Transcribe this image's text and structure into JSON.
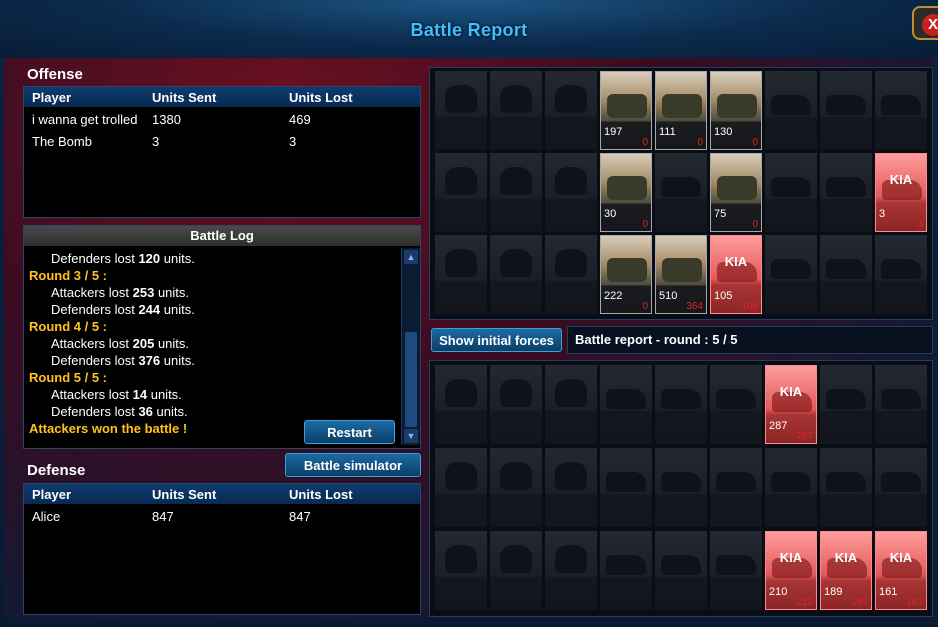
{
  "window": {
    "title": "Battle Report",
    "close_glyph": "X"
  },
  "offense": {
    "title": "Offense",
    "columns": [
      "Player",
      "Units Sent",
      "Units Lost"
    ],
    "rows": [
      {
        "player": "i wanna get trolled",
        "sent": "1380",
        "lost": "469"
      },
      {
        "player": "The Bomb",
        "sent": "3",
        "lost": "3"
      }
    ]
  },
  "battle_log": {
    "title": "Battle Log",
    "lines": [
      {
        "kind": "sub",
        "pre": "Defenders lost ",
        "num": "120",
        "post": " units."
      },
      {
        "kind": "round",
        "text": "Round 3 / 5 :"
      },
      {
        "kind": "sub",
        "pre": "Attackers lost ",
        "num": "253",
        "post": " units."
      },
      {
        "kind": "sub",
        "pre": "Defenders lost ",
        "num": "244",
        "post": " units."
      },
      {
        "kind": "round",
        "text": "Round 4 / 5 :"
      },
      {
        "kind": "sub",
        "pre": "Attackers lost ",
        "num": "205",
        "post": " units."
      },
      {
        "kind": "sub",
        "pre": "Defenders lost ",
        "num": "376",
        "post": " units."
      },
      {
        "kind": "round",
        "text": "Round 5 / 5 :"
      },
      {
        "kind": "sub",
        "pre": "Attackers lost ",
        "num": "14",
        "post": " units."
      },
      {
        "kind": "sub",
        "pre": "Defenders lost ",
        "num": "36",
        "post": " units."
      },
      {
        "kind": "won",
        "text": "Attackers won the battle !"
      }
    ],
    "restart_label": "Restart"
  },
  "battle_simulator_label": "Battle simulator",
  "defense": {
    "title": "Defense",
    "columns": [
      "Player",
      "Units Sent",
      "Units Lost"
    ],
    "rows": [
      {
        "player": "Alice",
        "sent": "847",
        "lost": "847"
      }
    ]
  },
  "show_initial_forces_label": "Show initial forces",
  "status_text": "Battle report - round : 5 / 5",
  "kia_label": "KIA",
  "offense_grid": [
    [
      {
        "t": "infantry"
      },
      {
        "t": "infantry"
      },
      {
        "t": "infantry"
      },
      {
        "t": "vehicle",
        "state": "active",
        "count": "197",
        "lost": "0"
      },
      {
        "t": "vehicle",
        "state": "active",
        "count": "111",
        "lost": "0"
      },
      {
        "t": "vehicle",
        "state": "active",
        "count": "130",
        "lost": "0"
      },
      {
        "t": "vehicle"
      },
      {
        "t": "vehicle"
      },
      {
        "t": "vehicle"
      }
    ],
    [
      {
        "t": "infantry"
      },
      {
        "t": "infantry"
      },
      {
        "t": "infantry"
      },
      {
        "t": "vehicle",
        "state": "active",
        "count": "30",
        "lost": "0"
      },
      {
        "t": "vehicle"
      },
      {
        "t": "vehicle",
        "state": "active",
        "count": "75",
        "lost": "0"
      },
      {
        "t": "vehicle"
      },
      {
        "t": "vehicle"
      },
      {
        "t": "vehicle",
        "state": "kia",
        "count": "3",
        "lost": "3"
      }
    ],
    [
      {
        "t": "infantry"
      },
      {
        "t": "infantry"
      },
      {
        "t": "infantry"
      },
      {
        "t": "vehicle",
        "state": "active",
        "count": "222",
        "lost": "0"
      },
      {
        "t": "vehicle",
        "state": "active",
        "count": "510",
        "lost": "364"
      },
      {
        "t": "vehicle",
        "state": "kia",
        "count": "105",
        "lost": "105"
      },
      {
        "t": "vehicle"
      },
      {
        "t": "vehicle"
      },
      {
        "t": "vehicle"
      }
    ]
  ],
  "defense_grid": [
    [
      {
        "t": "infantry"
      },
      {
        "t": "infantry"
      },
      {
        "t": "infantry"
      },
      {
        "t": "vehicle"
      },
      {
        "t": "vehicle"
      },
      {
        "t": "vehicle"
      },
      {
        "t": "vehicle",
        "state": "kia",
        "count": "287",
        "lost": "287"
      },
      {
        "t": "vehicle"
      },
      {
        "t": "vehicle"
      }
    ],
    [
      {
        "t": "infantry"
      },
      {
        "t": "infantry"
      },
      {
        "t": "infantry"
      },
      {
        "t": "vehicle"
      },
      {
        "t": "vehicle"
      },
      {
        "t": "vehicle"
      },
      {
        "t": "vehicle"
      },
      {
        "t": "vehicle"
      },
      {
        "t": "vehicle"
      }
    ],
    [
      {
        "t": "infantry"
      },
      {
        "t": "infantry"
      },
      {
        "t": "infantry"
      },
      {
        "t": "vehicle"
      },
      {
        "t": "vehicle"
      },
      {
        "t": "vehicle"
      },
      {
        "t": "vehicle",
        "state": "kia",
        "count": "210",
        "lost": "210"
      },
      {
        "t": "vehicle",
        "state": "kia",
        "count": "189",
        "lost": "189"
      },
      {
        "t": "vehicle",
        "state": "kia",
        "count": "161",
        "lost": "161"
      }
    ]
  ]
}
